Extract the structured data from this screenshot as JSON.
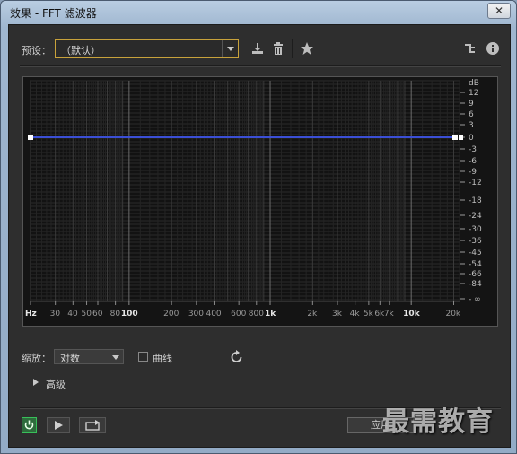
{
  "window": {
    "title": "效果 - FFT 滤波器",
    "close_glyph": "✕"
  },
  "preset": {
    "label": "预设：",
    "value": "（默认）"
  },
  "toolbar_icons": [
    "download-icon",
    "trash-icon",
    "star-icon",
    "routing-icon",
    "info-icon"
  ],
  "chart_data": {
    "type": "line",
    "title": "",
    "xlabel": "Hz",
    "ylabel": "dB",
    "x_scale": "log",
    "x_ticks": [
      "Hz",
      "30",
      "40",
      "50",
      "60",
      "80",
      "100",
      "200",
      "300",
      "400",
      "600",
      "800",
      "1k",
      "2k",
      "3k",
      "4k",
      "5k",
      "6k",
      "7k",
      "10k",
      "20k"
    ],
    "y_ticks": [
      "dB",
      "12",
      "9",
      "6",
      "3",
      "0",
      "-3",
      "-6",
      "-9",
      "-12",
      "-18",
      "-24",
      "-30",
      "-36",
      "-45",
      "-54",
      "-66",
      "-84",
      "- ∞"
    ],
    "series": [
      {
        "color": "#3b4fd6",
        "x": [
          20,
          22000
        ],
        "y": [
          0,
          0
        ]
      }
    ],
    "grid": true
  },
  "controls": {
    "zoom_label": "缩放：",
    "zoom_value": "对数",
    "curve_label": "曲线",
    "curve_checked": false,
    "advanced_label": "高级",
    "apply_label": "应用"
  },
  "watermark": "最需教育",
  "colors": {
    "accent_border": "#c8a23b",
    "power_on": "#38c05a",
    "curve": "#3b4fd6"
  }
}
